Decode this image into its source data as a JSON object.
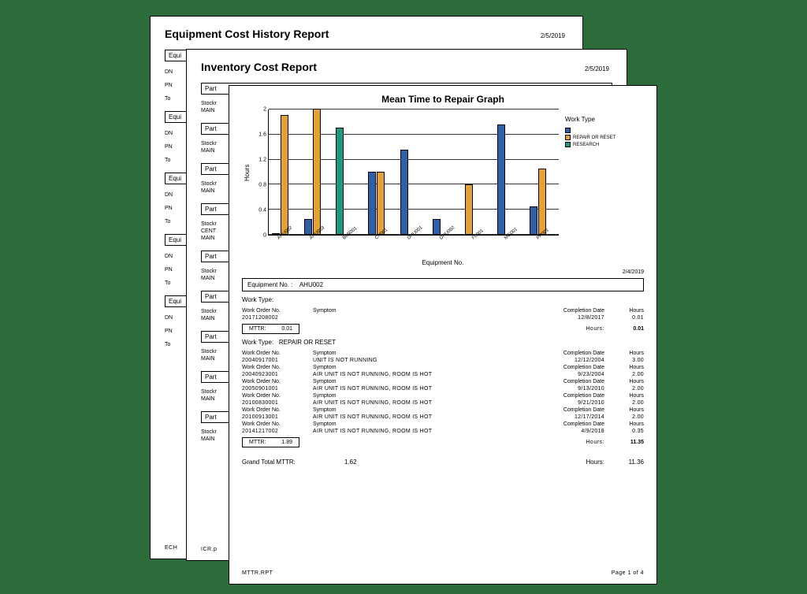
{
  "back": {
    "title": "Equipment Cost History Report",
    "date": "2/5/2019",
    "sections": [
      {
        "header": "Equi",
        "rows": [
          "DN",
          "PN",
          "To"
        ]
      },
      {
        "header": "Equi",
        "rows": [
          "DN",
          "PN",
          "To"
        ]
      },
      {
        "header": "Equi",
        "rows": [
          "DN",
          "PN",
          "To"
        ]
      },
      {
        "header": "Equi",
        "rows": [
          "DN",
          "PN",
          "To"
        ]
      },
      {
        "header": "Equi",
        "rows": [
          "DN",
          "PN",
          "To"
        ]
      }
    ],
    "footer_code": "ECH"
  },
  "mid": {
    "title": "Inventory Cost Report",
    "date": "2/5/2019",
    "parts": [
      {
        "header": "Part",
        "lines": [
          "Stockr",
          "MAIN"
        ]
      },
      {
        "header": "Part",
        "lines": [
          "Stockr",
          "MAIN"
        ]
      },
      {
        "header": "Part",
        "lines": [
          "Stockr",
          "MAIN"
        ]
      },
      {
        "header": "Part",
        "lines": [
          "Stockr",
          "CENT",
          "MAIN"
        ]
      },
      {
        "header": "Part",
        "lines": [
          "Stockr",
          "MAIN"
        ]
      },
      {
        "header": "Part",
        "lines": [
          "Stockr",
          "MAIN"
        ]
      },
      {
        "header": "Part",
        "lines": [
          "Stockr",
          "MAIN"
        ]
      },
      {
        "header": "Part",
        "lines": [
          "Stockr",
          "MAIN"
        ]
      },
      {
        "header": "Part",
        "lines": [
          "Stockr",
          "MAIN"
        ]
      }
    ],
    "footer_code": "ICR.p"
  },
  "front": {
    "chart_title": "Mean Time to Repair Graph",
    "legend_title": "Work Type",
    "legend_items": [
      "",
      "REPAIR OR RESET",
      "RESEARCH"
    ],
    "ylabel": "Hours",
    "xlabel": "Equipment No.",
    "report_date": "2/4/2019",
    "eq_label": "Equipment No. :",
    "eq_value": "AHU002",
    "wt_label": "Work Type:",
    "wt2_label": "Work Type:",
    "wt2_value": "REPAIR OR RESET",
    "col_wo": "Work Order No.",
    "col_sym": "Symptom",
    "col_cd": "Completion Date",
    "col_hr": "Hours",
    "section1": {
      "rows": [
        {
          "wo": "20171208002",
          "sym": "",
          "cd": "12/8/2017",
          "hr": "0.01"
        }
      ],
      "mttr_label": "MTTR:",
      "mttr_val": "0.01",
      "hours_label": "Hours:",
      "hours_val": "0.01"
    },
    "section2": {
      "rows": [
        {
          "wo": "20040917001",
          "sym": "UNIT IS NOT RUNNING",
          "cd": "12/12/2004",
          "hr": "3.00"
        },
        {
          "wo": "20040923001",
          "sym": "AIR UNIT IS NOT RUNNING, ROOM IS HOT",
          "cd": "9/23/2004",
          "hr": "2.00"
        },
        {
          "wo": "20050901001",
          "sym": "AIR UNIT IS NOT RUNNING, ROOM IS HOT",
          "cd": "9/13/2010",
          "hr": "2.00"
        },
        {
          "wo": "20100830001",
          "sym": "AIR UNIT IS NOT RUNNING, ROOM IS HOT",
          "cd": "9/21/2010",
          "hr": "2.00"
        },
        {
          "wo": "20100913001",
          "sym": "AIR UNIT IS NOT RUNNING, ROOM IS HOT",
          "cd": "12/17/2014",
          "hr": "2.00"
        },
        {
          "wo": "20141217002",
          "sym": "AIR UNIT IS NOT RUNNING, ROOM IS HOT",
          "cd": "4/9/2018",
          "hr": "0.35"
        }
      ],
      "mttr_label": "MTTR:",
      "mttr_val": "1.89",
      "hours_label": "Hours:",
      "hours_val": "11.35"
    },
    "grand": {
      "label": "Grand Total MTTR:",
      "mttr": "1.62",
      "hours_label": "Hours:",
      "hours": "11.36"
    },
    "footer_code": "MTTR.RPT",
    "page_label": "Page 1 of 4"
  },
  "chart_data": {
    "type": "bar",
    "ylabel": "Hours",
    "xlabel": "Equipment No.",
    "ylim": [
      0,
      2
    ],
    "yticks": [
      0,
      0.4,
      0.8,
      1.2,
      1.6,
      2
    ],
    "categories": [
      "AHU002",
      "AHU003",
      "BLR001",
      "CH001",
      "DHU001",
      "DHU002",
      "FL001",
      "MG001",
      "PR001"
    ],
    "series_names": [
      "blank",
      "REPAIR OR RESET",
      "RESEARCH"
    ],
    "equipment": [
      {
        "name": "AHU002",
        "bars": [
          {
            "series": 0,
            "color": "blue",
            "value": 0.01
          },
          {
            "series": 1,
            "color": "orange",
            "value": 1.9
          }
        ]
      },
      {
        "name": "AHU003",
        "bars": [
          {
            "series": 0,
            "color": "blue",
            "value": 0.25
          },
          {
            "series": 1,
            "color": "orange",
            "value": 2.0
          }
        ]
      },
      {
        "name": "BLR001",
        "bars": [
          {
            "series": 2,
            "color": "green",
            "value": 1.7
          }
        ]
      },
      {
        "name": "CH001",
        "bars": [
          {
            "series": 0,
            "color": "blue",
            "value": 1.0
          },
          {
            "series": 1,
            "color": "orange",
            "value": 1.0
          }
        ]
      },
      {
        "name": "DHU001",
        "bars": [
          {
            "series": 0,
            "color": "blue",
            "value": 1.35
          }
        ]
      },
      {
        "name": "DHU002",
        "bars": [
          {
            "series": 0,
            "color": "blue",
            "value": 0.25
          }
        ]
      },
      {
        "name": "FL001",
        "bars": [
          {
            "series": 1,
            "color": "orange",
            "value": 0.8
          }
        ]
      },
      {
        "name": "MG001",
        "bars": [
          {
            "series": 0,
            "color": "blue",
            "value": 1.75
          }
        ]
      },
      {
        "name": "PR001",
        "bars": [
          {
            "series": 0,
            "color": "blue",
            "value": 0.45
          },
          {
            "series": 1,
            "color": "orange",
            "value": 1.05
          }
        ]
      }
    ]
  }
}
